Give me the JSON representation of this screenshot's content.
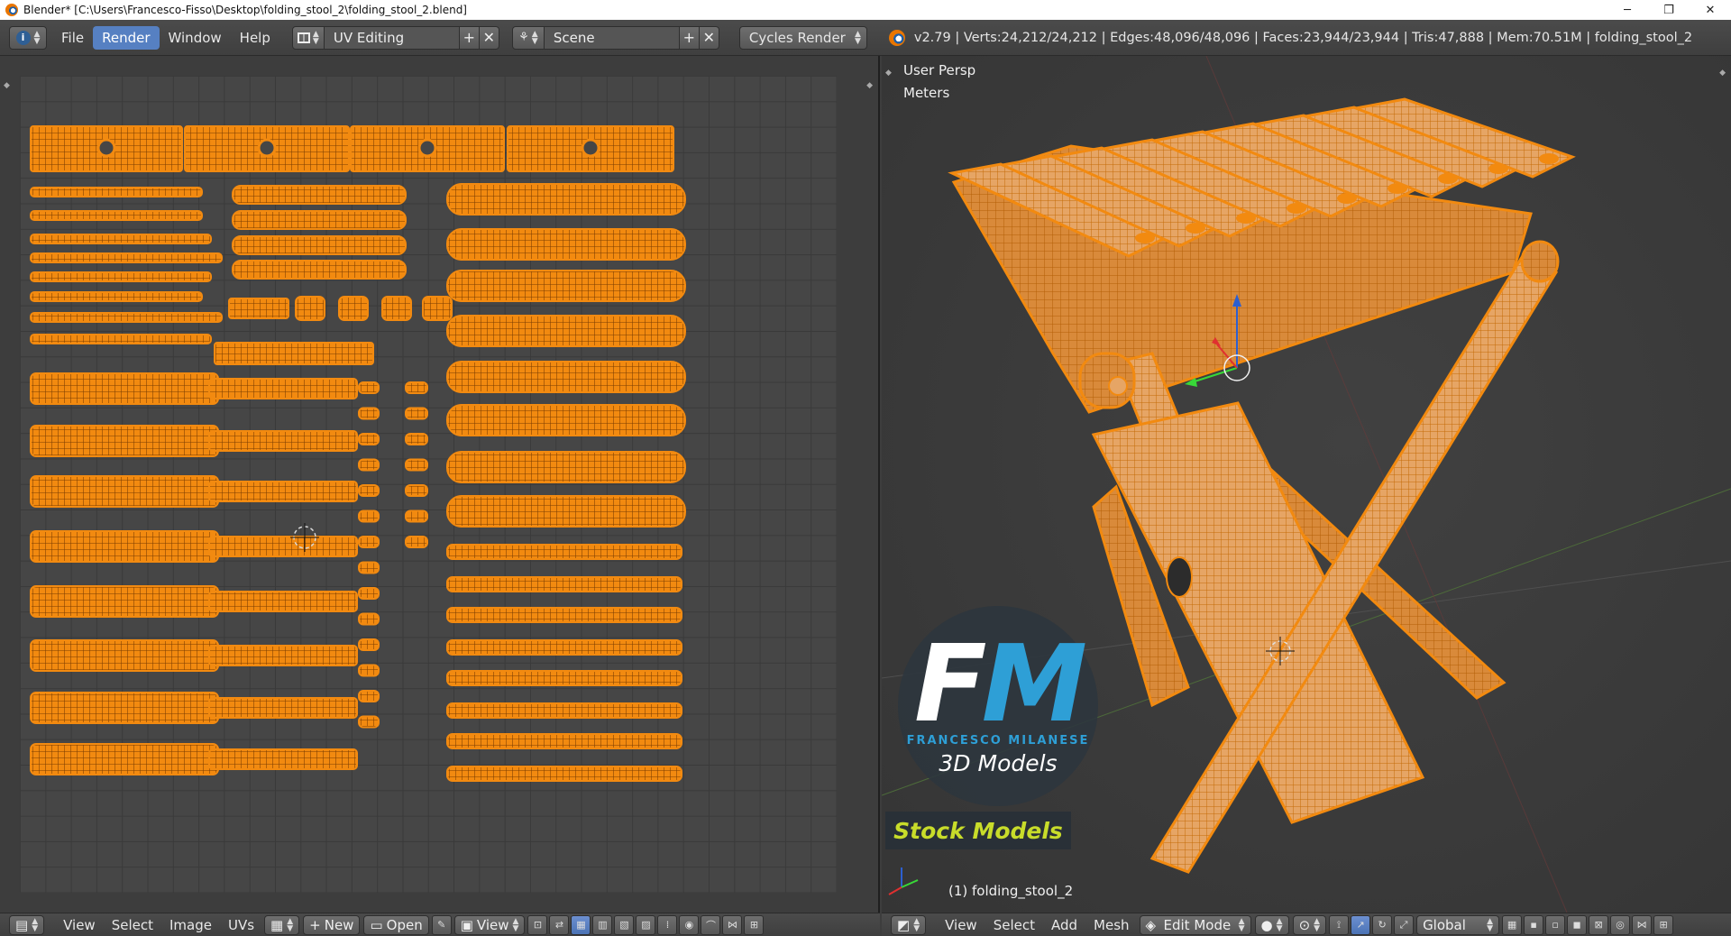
{
  "window": {
    "title": "Blender* [C:\\Users\\Francesco-Fisso\\Desktop\\folding_stool_2\\folding_stool_2.blend]",
    "minimize": "─",
    "maximize": "❐",
    "close": "✕"
  },
  "header": {
    "menus": [
      "File",
      "Render",
      "Window",
      "Help"
    ],
    "active_menu": "Render",
    "layout": "UV Editing",
    "scene": "Scene",
    "render_engine": "Cycles Render",
    "stats": "v2.79 | Verts:24,212/24,212 | Edges:48,096/48,096 | Faces:23,944/23,944 | Tris:47,888 | Mem:70.51M | folding_stool_2",
    "add_symbol": "+",
    "remove_symbol": "✕"
  },
  "viewport": {
    "view_name": "User Persp",
    "units": "Meters",
    "object_label": "(1) folding_stool_2"
  },
  "watermark": {
    "letter_f": "F",
    "letter_m": "M",
    "name": "FRANCESCO MILANESE",
    "subtitle": "3D Models",
    "badge": "Stock Models"
  },
  "uv_footer": {
    "menus": [
      "View",
      "Select",
      "Image",
      "UVs"
    ],
    "new_button": "New",
    "open_button": "Open",
    "view_dropdown": "View"
  },
  "vp_footer": {
    "menus": [
      "View",
      "Select",
      "Add",
      "Mesh"
    ],
    "mode": "Edit Mode",
    "orientation": "Global"
  },
  "colors": {
    "mesh_orange": "#f28a10",
    "mesh_wire": "#7a3c00",
    "active_blue": "#5680c2",
    "watermark_blue": "#2e9fd6",
    "stock_yellow": "#c8dc2a"
  }
}
